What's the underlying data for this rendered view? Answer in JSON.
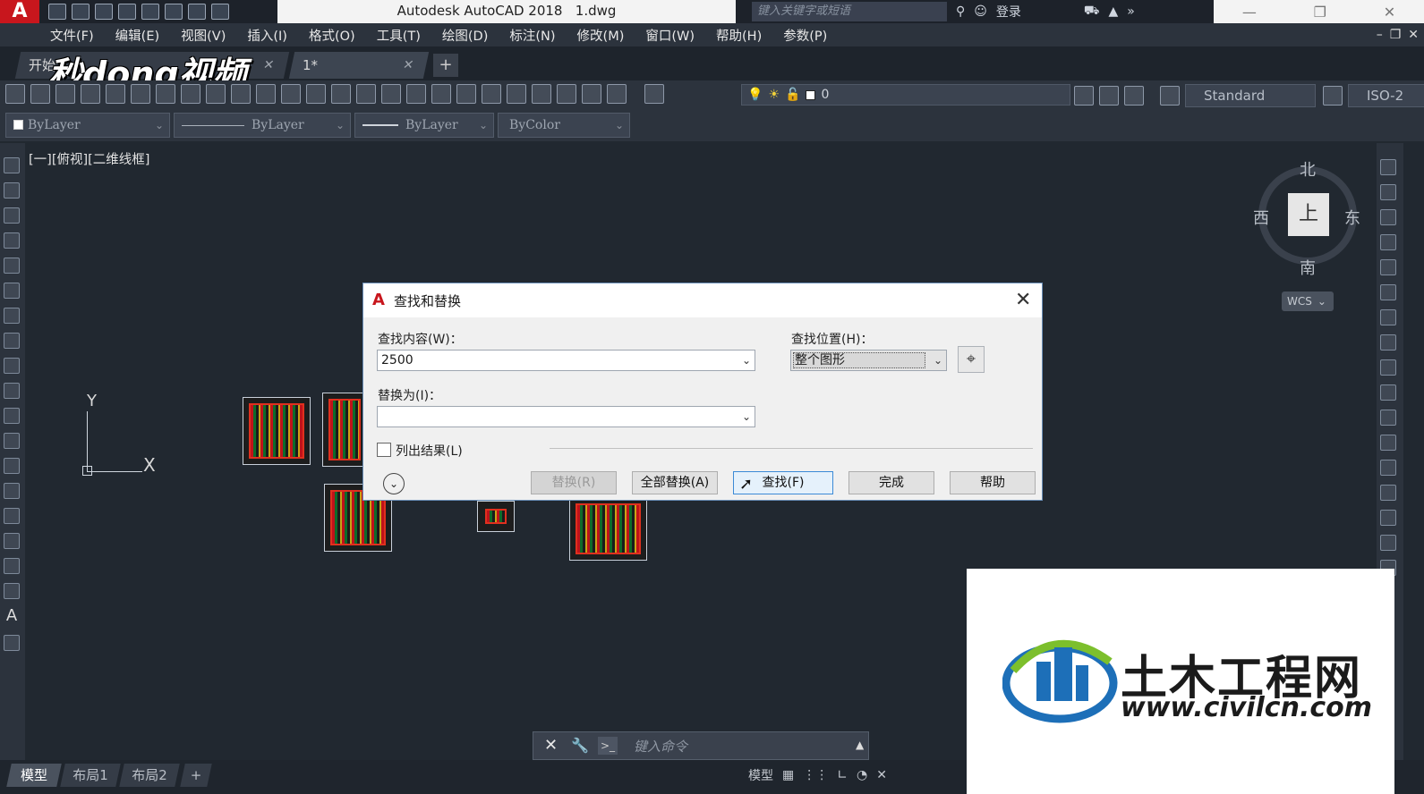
{
  "titlebar": {
    "app_title": "Autodesk AutoCAD 2018",
    "file_name": "1.dwg",
    "search_placeholder": "键入关键字或短语",
    "login": "登录"
  },
  "menu": [
    "文件(F)",
    "编辑(E)",
    "视图(V)",
    "插入(I)",
    "格式(O)",
    "工具(T)",
    "绘图(D)",
    "标注(N)",
    "修改(M)",
    "窗口(W)",
    "帮助(H)",
    "参数(P)"
  ],
  "tabs": {
    "start": "开始",
    "current": "1*",
    "add": "+"
  },
  "video_watermark": "秒dong视频",
  "toolbar": {
    "layer_value": "0",
    "text_style": "Standard",
    "dim_style": "ISO-2"
  },
  "properties": {
    "color": "ByLayer",
    "linetype": "ByLayer",
    "lineweight": "ByLayer",
    "plotstyle": "ByColor"
  },
  "viewport": {
    "label": "[一][俯视][二维线框]",
    "ucs_x": "X",
    "ucs_y": "Y"
  },
  "viewcube": {
    "north": "北",
    "south": "南",
    "east": "东",
    "west": "西",
    "face": "上",
    "wcs": "WCS"
  },
  "dialog": {
    "title": "查找和替换",
    "find_label": "查找内容(W)：",
    "find_value": "2500",
    "replace_label": "替换为(I)：",
    "replace_value": "",
    "location_label": "查找位置(H)：",
    "location_value": "整个图形",
    "list_results_label": "列出结果(L)",
    "list_results_checked": false,
    "buttons": {
      "replace": "替换(R)",
      "replace_all": "全部替换(A)",
      "find": "查找(F)",
      "done": "完成",
      "help": "帮助"
    }
  },
  "commandline": {
    "placeholder": "键入命令"
  },
  "statusbar": {
    "layout_tabs": [
      "模型",
      "布局1",
      "布局2"
    ],
    "add_tab": "+",
    "model_label": "模型"
  },
  "logo": {
    "name_cn": "土木工程网",
    "url": "www.civilcn.com"
  },
  "colors": {
    "accent": "#c8161d",
    "canvas": "#212830",
    "dialog_bg": "#f0f0f0"
  }
}
